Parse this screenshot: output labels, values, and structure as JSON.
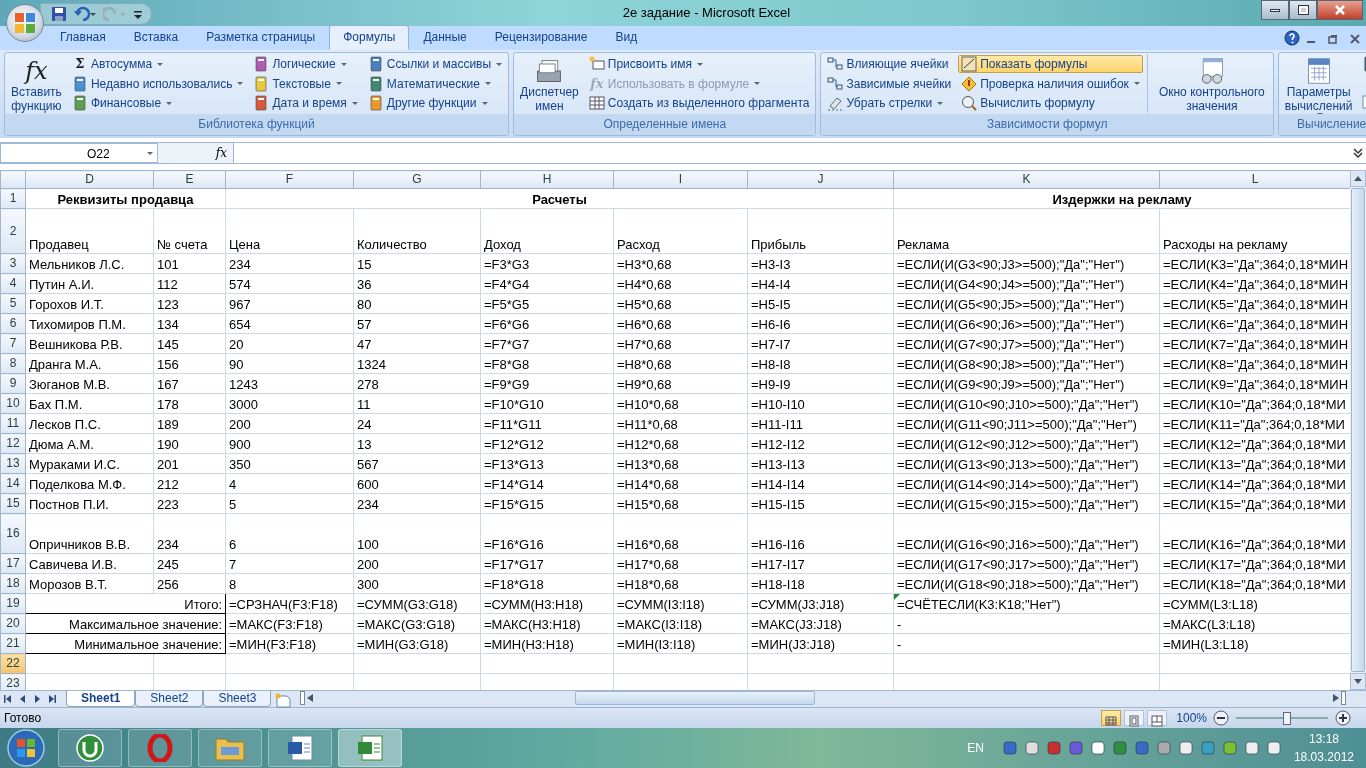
{
  "window": {
    "title": "2е задание - Microsoft Excel"
  },
  "ribbon": {
    "tabs": [
      {
        "label": "Главная",
        "selected": false
      },
      {
        "label": "Вставка",
        "selected": false
      },
      {
        "label": "Разметка страницы",
        "selected": false
      },
      {
        "label": "Формулы",
        "selected": true
      },
      {
        "label": "Данные",
        "selected": false
      },
      {
        "label": "Рецензирование",
        "selected": false
      },
      {
        "label": "Вид",
        "selected": false
      }
    ],
    "groups": [
      {
        "label": "Библиотека функций",
        "columns": [
          [
            {
              "kind": "large",
              "label": "Вставить функцию",
              "glyph": "fx"
            }
          ],
          [
            {
              "kind": "small",
              "label": "Автосумма",
              "glyph": "Σ",
              "dropdown": true
            },
            {
              "kind": "small",
              "label": "Недавно использовались",
              "dropdown": true
            },
            {
              "kind": "small",
              "label": "Финансовые",
              "dropdown": true
            }
          ],
          [
            {
              "kind": "small",
              "label": "Логические",
              "dropdown": true
            },
            {
              "kind": "small",
              "label": "Текстовые",
              "dropdown": true
            },
            {
              "kind": "small",
              "label": "Дата и время",
              "dropdown": true
            }
          ],
          [
            {
              "kind": "small",
              "label": "Ссылки и массивы",
              "dropdown": true
            },
            {
              "kind": "small",
              "label": "Математические",
              "dropdown": true
            },
            {
              "kind": "small",
              "label": "Другие функции",
              "dropdown": true
            }
          ]
        ]
      },
      {
        "label": "Определенные имена",
        "columns": [
          [
            {
              "kind": "large",
              "label": "Диспетчер имен"
            }
          ],
          [
            {
              "kind": "small",
              "label": "Присвоить имя",
              "dropdown": true
            },
            {
              "kind": "small",
              "label": "Использовать в формуле",
              "glyph": "fx",
              "dropdown": true,
              "disabled": true
            },
            {
              "kind": "small",
              "label": "Создать из выделенного фрагмента"
            }
          ]
        ]
      },
      {
        "label": "Зависимости формул",
        "columns": [
          [
            {
              "kind": "small",
              "label": "Влияющие ячейки"
            },
            {
              "kind": "small",
              "label": "Зависимые ячейки"
            },
            {
              "kind": "small",
              "label": "Убрать стрелки",
              "dropdown": true
            }
          ],
          [
            {
              "kind": "small",
              "label": "Показать формулы",
              "on": true
            },
            {
              "kind": "small",
              "label": "Проверка наличия ошибок",
              "dropdown": true
            },
            {
              "kind": "small",
              "label": "Вычислить формулу"
            }
          ],
          [
            {
              "kind": "large",
              "label": "Окно контрольного значения"
            }
          ]
        ]
      },
      {
        "label": "Вычисление",
        "columns": [
          [
            {
              "kind": "large",
              "label": "Параметры вычислений",
              "dropdown": true
            }
          ],
          [
            {
              "kind": "icon"
            },
            {
              "kind": "icon"
            }
          ]
        ]
      }
    ]
  },
  "formula_bar": {
    "name_box": "O22",
    "function_button": "fx"
  },
  "sheet": {
    "columns": [
      "D",
      "E",
      "F",
      "G",
      "H",
      "I",
      "J",
      "K",
      "L"
    ],
    "rows": [
      {
        "number": "1",
        "selected": false,
        "kind": "section",
        "cells": [
          "Реквизиты продавца",
          "Расчеты",
          "Издержки на рекламу"
        ]
      },
      {
        "number": "2",
        "selected": false,
        "kind": "header",
        "cells": [
          "Продавец",
          "№ счета",
          "Цена",
          "Количество",
          "Доход",
          "Расход",
          "Прибыль",
          "Реклама",
          "Расходы на рекламу"
        ]
      },
      {
        "number": "3",
        "selected": false,
        "kind": "data",
        "cells": [
          "Мельников Л.С.",
          "101",
          "234",
          "15",
          "=F3*G3",
          "=H3*0,68",
          "=H3-I3",
          "=ЕСЛИ(И(G3<90;J3>=500);\"Да\";\"Нет\")",
          "=ЕСЛИ(K3=\"Да\";364;0,18*МИН"
        ]
      },
      {
        "number": "4",
        "selected": false,
        "kind": "data",
        "cells": [
          "Путин А.И.",
          "112",
          "574",
          "36",
          "=F4*G4",
          "=H4*0,68",
          "=H4-I4",
          "=ЕСЛИ(И(G4<90;J4>=500);\"Да\";\"Нет\")",
          "=ЕСЛИ(K4=\"Да\";364;0,18*МИН"
        ]
      },
      {
        "number": "5",
        "selected": false,
        "kind": "data",
        "cells": [
          "Горохов И.Т.",
          "123",
          "967",
          "80",
          "=F5*G5",
          "=H5*0,68",
          "=H5-I5",
          "=ЕСЛИ(И(G5<90;J5>=500);\"Да\";\"Нет\")",
          "=ЕСЛИ(K5=\"Да\";364;0,18*МИН"
        ]
      },
      {
        "number": "6",
        "selected": false,
        "kind": "data",
        "cells": [
          "Тихомиров П.М.",
          "134",
          "654",
          "57",
          "=F6*G6",
          "=H6*0,68",
          "=H6-I6",
          "=ЕСЛИ(И(G6<90;J6>=500);\"Да\";\"Нет\")",
          "=ЕСЛИ(K6=\"Да\";364;0,18*МИН"
        ]
      },
      {
        "number": "7",
        "selected": false,
        "kind": "data",
        "cells": [
          "Вешникова Р.В.",
          "145",
          "20",
          "47",
          "=F7*G7",
          "=H7*0,68",
          "=H7-I7",
          "=ЕСЛИ(И(G7<90;J7>=500);\"Да\";\"Нет\")",
          "=ЕСЛИ(K7=\"Да\";364;0,18*МИН"
        ]
      },
      {
        "number": "8",
        "selected": false,
        "kind": "data",
        "cells": [
          "Дранга М.А.",
          "156",
          "90",
          "1324",
          "=F8*G8",
          "=H8*0,68",
          "=H8-I8",
          "=ЕСЛИ(И(G8<90;J8>=500);\"Да\";\"Нет\")",
          "=ЕСЛИ(K8=\"Да\";364;0,18*МИН"
        ]
      },
      {
        "number": "9",
        "selected": false,
        "kind": "data",
        "cells": [
          "Зюганов М.В.",
          "167",
          "1243",
          "278",
          "=F9*G9",
          "=H9*0,68",
          "=H9-I9",
          "=ЕСЛИ(И(G9<90;J9>=500);\"Да\";\"Нет\")",
          "=ЕСЛИ(K9=\"Да\";364;0,18*МИН"
        ]
      },
      {
        "number": "10",
        "selected": false,
        "kind": "data",
        "cells": [
          "Бах П.М.",
          "178",
          "3000",
          "11",
          "=F10*G10",
          "=H10*0,68",
          "=H10-I10",
          "=ЕСЛИ(И(G10<90;J10>=500);\"Да\";\"Нет\")",
          "=ЕСЛИ(K10=\"Да\";364;0,18*МИ"
        ]
      },
      {
        "number": "11",
        "selected": false,
        "kind": "data",
        "cells": [
          "Лесков П.С.",
          "189",
          "200",
          "24",
          "=F11*G11",
          "=H11*0,68",
          "=H11-I11",
          "=ЕСЛИ(И(G11<90;J11>=500);\"Да\";\"Нет\")",
          "=ЕСЛИ(K11=\"Да\";364;0,18*МИ"
        ]
      },
      {
        "number": "12",
        "selected": false,
        "kind": "data",
        "cells": [
          "Дюма А.М.",
          "190",
          "900",
          "13",
          "=F12*G12",
          "=H12*0,68",
          "=H12-I12",
          "=ЕСЛИ(И(G12<90;J12>=500);\"Да\";\"Нет\")",
          "=ЕСЛИ(K12=\"Да\";364;0,18*МИ"
        ]
      },
      {
        "number": "13",
        "selected": false,
        "kind": "data",
        "cells": [
          "Мураками И.С.",
          "201",
          "350",
          "567",
          "=F13*G13",
          "=H13*0,68",
          "=H13-I13",
          "=ЕСЛИ(И(G13<90;J13>=500);\"Да\";\"Нет\")",
          "=ЕСЛИ(K13=\"Да\";364;0,18*МИ"
        ]
      },
      {
        "number": "14",
        "selected": false,
        "kind": "data",
        "cells": [
          "Поделкова М.Ф.",
          "212",
          "4",
          "600",
          "=F14*G14",
          "=H14*0,68",
          "=H14-I14",
          "=ЕСЛИ(И(G14<90;J14>=500);\"Да\";\"Нет\")",
          "=ЕСЛИ(K14=\"Да\";364;0,18*МИ"
        ]
      },
      {
        "number": "15",
        "selected": false,
        "kind": "data",
        "cells": [
          "Постнов П.И.",
          "223",
          "5",
          "234",
          "=F15*G15",
          "=H15*0,68",
          "=H15-I15",
          "=ЕСЛИ(И(G15<90;J15>=500);\"Да\";\"Нет\")",
          "=ЕСЛИ(K15=\"Да\";364;0,18*МИ"
        ]
      },
      {
        "number": "16",
        "selected": false,
        "kind": "data",
        "cells": [
          "Опричников В.В.",
          "234",
          "6",
          "100",
          "=F16*G16",
          "=H16*0,68",
          "=H16-I16",
          "=ЕСЛИ(И(G16<90;J16>=500);\"Да\";\"Нет\")",
          "=ЕСЛИ(K16=\"Да\";364;0,18*МИ"
        ]
      },
      {
        "number": "17",
        "selected": false,
        "kind": "data",
        "cells": [
          "Савичева И.В.",
          "245",
          "7",
          "200",
          "=F17*G17",
          "=H17*0,68",
          "=H17-I17",
          "=ЕСЛИ(И(G17<90;J17>=500);\"Да\";\"Нет\")",
          "=ЕСЛИ(K17=\"Да\";364;0,18*МИ"
        ]
      },
      {
        "number": "18",
        "selected": false,
        "kind": "data",
        "cells": [
          "Морозов В.Т.",
          "256",
          "8",
          "300",
          "=F18*G18",
          "=H18*0,68",
          "=H18-I18",
          "=ЕСЛИ(И(G18<90;J18>=500);\"Да\";\"Нет\")",
          "=ЕСЛИ(K18=\"Да\";364;0,18*МИ"
        ]
      },
      {
        "number": "19",
        "selected": false,
        "kind": "summary",
        "cells": [
          "Итого:",
          "=СРЗНАЧ(F3:F18)",
          "=СУММ(G3:G18)",
          "=СУММ(H3:H18)",
          "=СУММ(I3:I18)",
          "=СУММ(J3:J18)",
          {
            "text": "=СЧЁТЕСЛИ(K3:K18;\"Нет\")",
            "flagged": true
          },
          "=СУММ(L3:L18)"
        ]
      },
      {
        "number": "20",
        "selected": false,
        "kind": "summary",
        "cells": [
          "Максимальное значение:",
          "=МАКС(F3:F18)",
          "=МАКС(G3:G18)",
          "=МАКС(H3:H18)",
          "=МАКС(I3:I18)",
          "=МАКС(J3:J18)",
          "-",
          "=МАКС(L3:L18)"
        ]
      },
      {
        "number": "21",
        "selected": false,
        "kind": "summary",
        "cells": [
          "Минимальное значение:",
          "=МИН(F3:F18)",
          "=МИН(G3:G18)",
          "=МИН(H3:H18)",
          "=МИН(I3:I18)",
          "=МИН(J3:J18)",
          "-",
          "=МИН(L3:L18)"
        ]
      },
      {
        "number": "22",
        "selected": true
      },
      {
        "number": "23",
        "selected": false
      }
    ]
  },
  "sheet_tabs": [
    {
      "label": "Sheet1",
      "selected": true
    },
    {
      "label": "Sheet2",
      "selected": false
    },
    {
      "label": "Sheet3",
      "selected": false
    }
  ],
  "status_bar": {
    "text": "Готово",
    "views": [
      {
        "selected": true
      },
      {
        "selected": false
      },
      {
        "selected": false
      }
    ],
    "zoom": "100%",
    "zoom_slider": {
      "level": 0.55
    }
  },
  "taskbar": {
    "apps": [
      {
        "kind": "torrent",
        "active": false
      },
      {
        "kind": "browser",
        "active": false
      },
      {
        "kind": "folder",
        "active": false
      },
      {
        "kind": "word",
        "active": false
      },
      {
        "kind": "excel",
        "active": true
      }
    ],
    "language": "EN",
    "time": "13:18",
    "date": "18.03.2012"
  }
}
